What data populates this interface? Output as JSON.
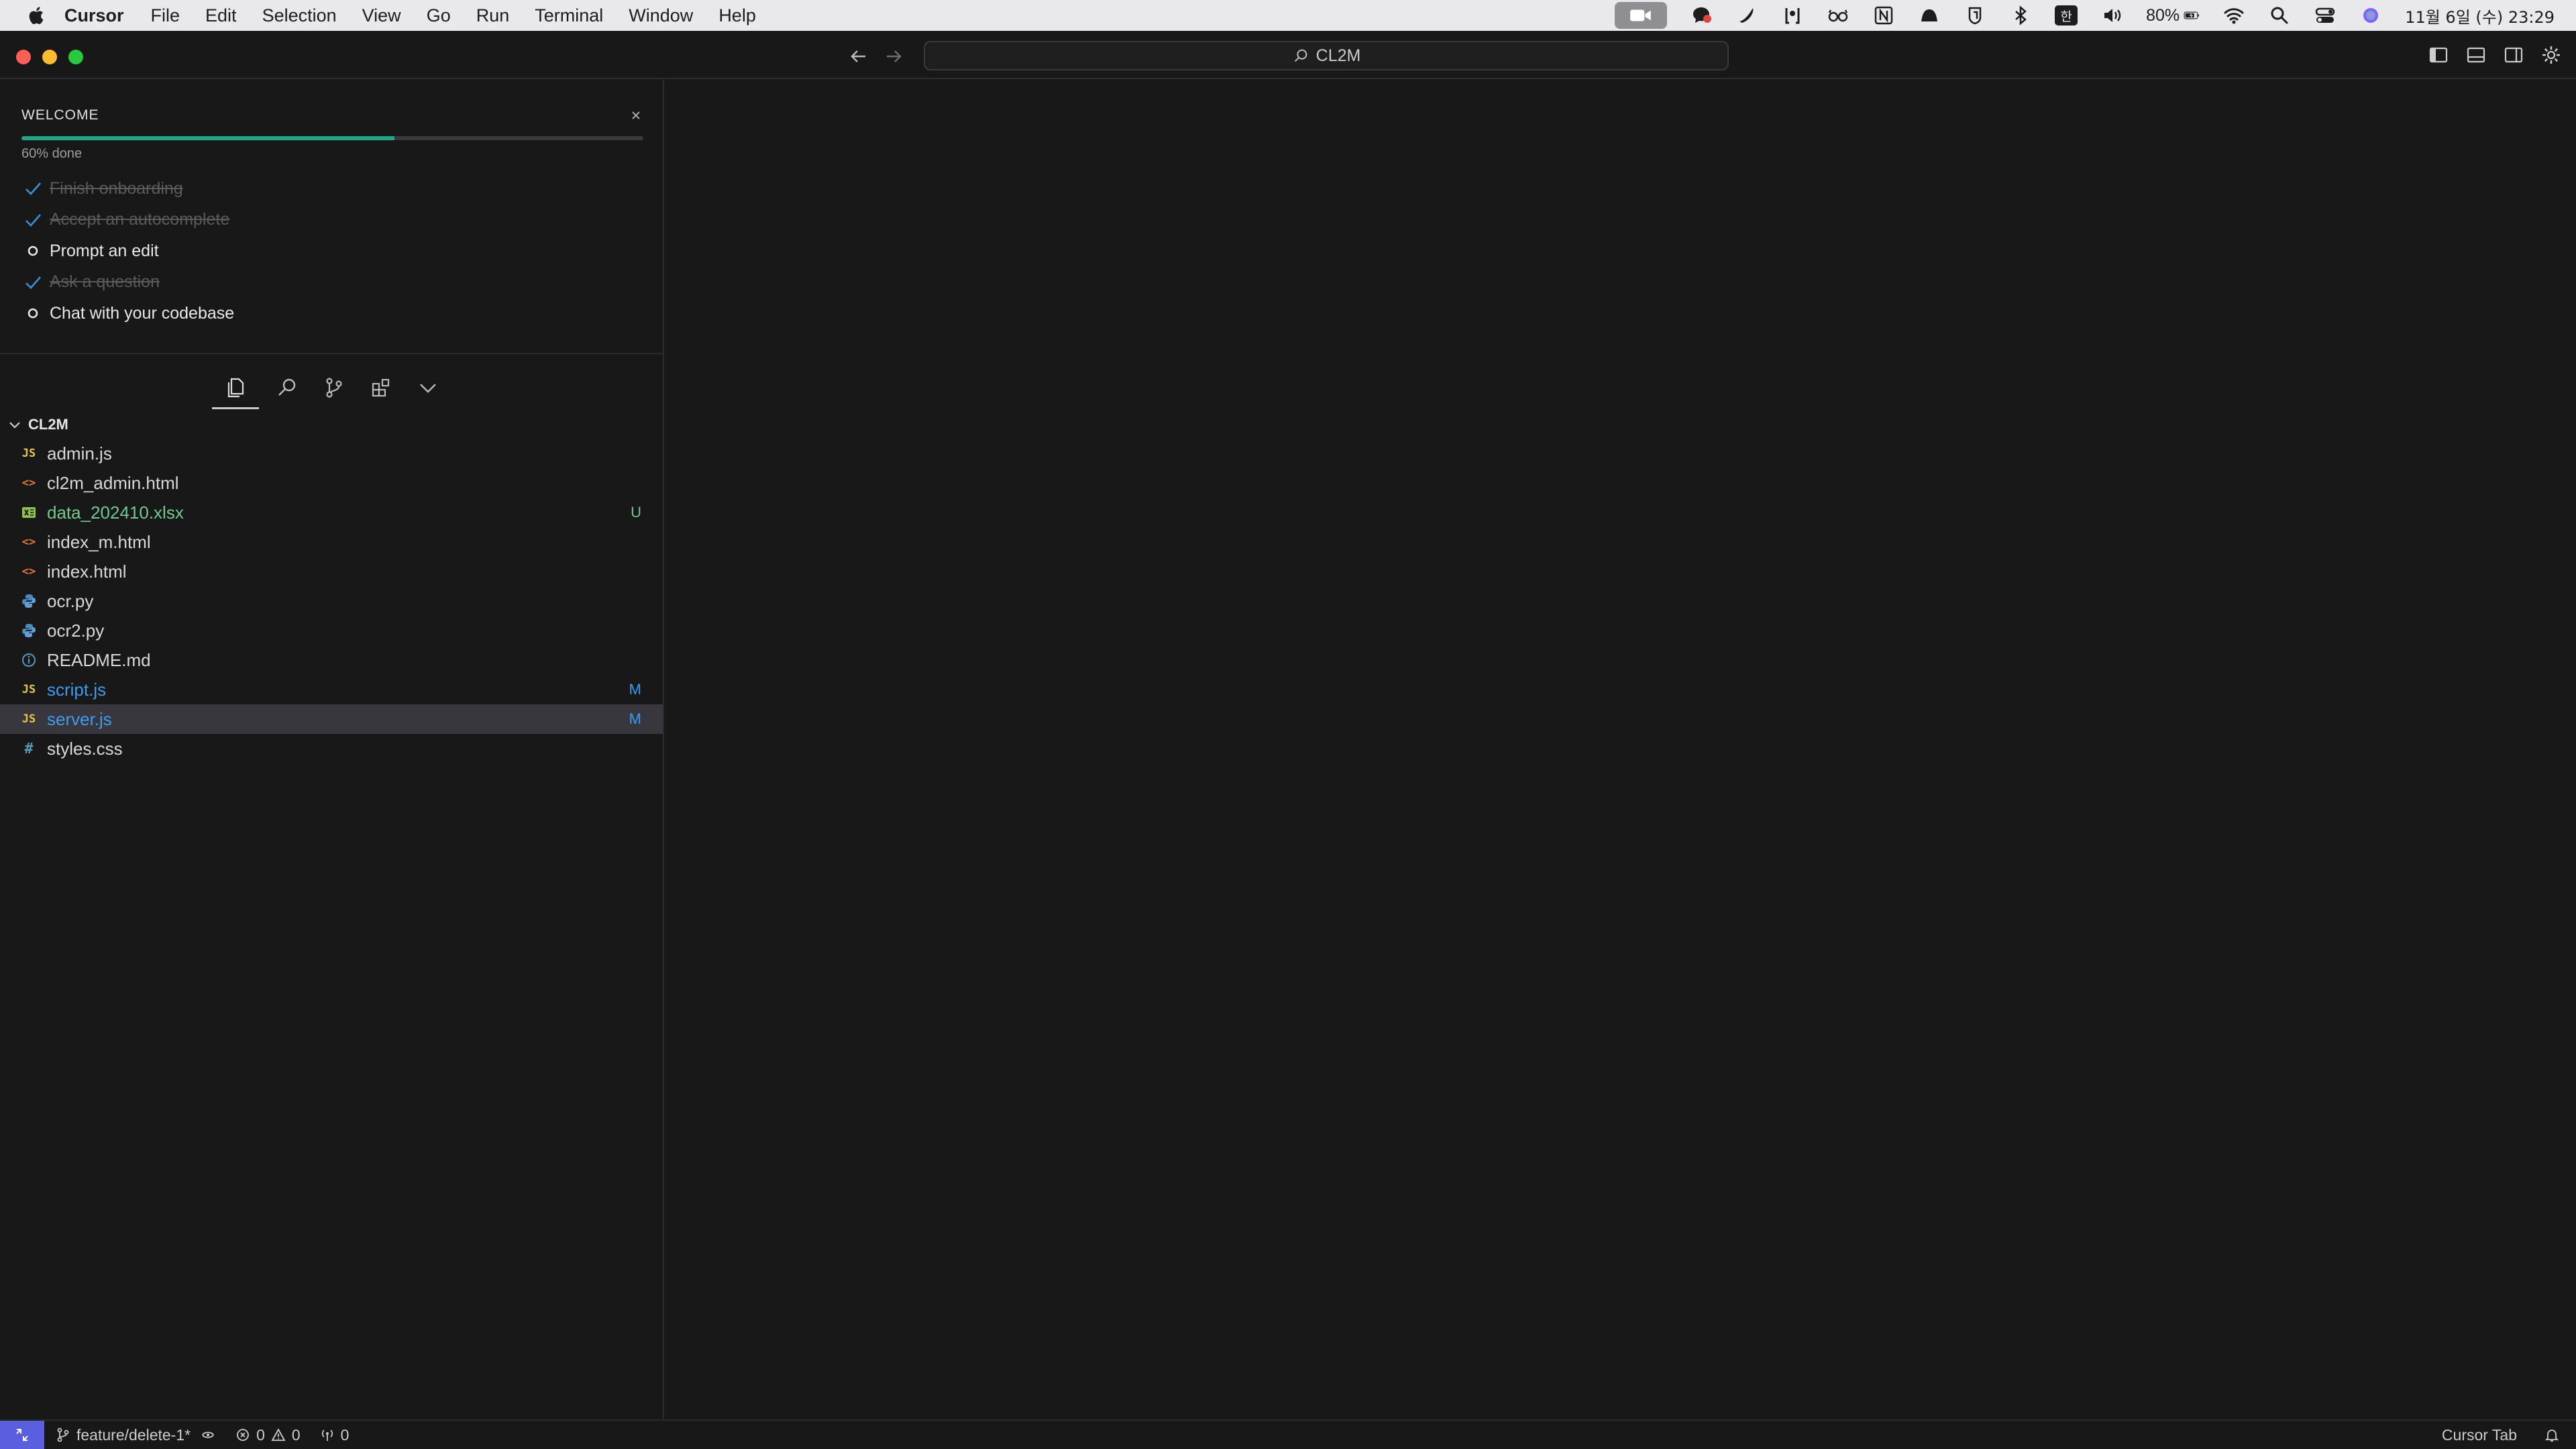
{
  "menubar": {
    "app_name": "Cursor",
    "items": [
      "File",
      "Edit",
      "Selection",
      "View",
      "Go",
      "Run",
      "Terminal",
      "Window",
      "Help"
    ],
    "battery_percent": "80%",
    "datetime": "11월 6일 (수) 23:29",
    "input_method": "한"
  },
  "window": {
    "search_label": "CL2M"
  },
  "welcome": {
    "title": "WELCOME",
    "progress": 0.6,
    "progress_label": "60% done",
    "items": [
      {
        "label": "Finish onboarding",
        "done": true
      },
      {
        "label": "Accept an autocomplete",
        "done": true
      },
      {
        "label": "Prompt an edit",
        "done": false
      },
      {
        "label": "Ask a question",
        "done": true
      },
      {
        "label": "Chat with your codebase",
        "done": false
      }
    ]
  },
  "explorer": {
    "folder_name": "CL2M",
    "files": [
      {
        "name": "admin.js",
        "type": "js",
        "status": ""
      },
      {
        "name": "cl2m_admin.html",
        "type": "html",
        "status": ""
      },
      {
        "name": "data_202410.xlsx",
        "type": "xlsx",
        "status": "U"
      },
      {
        "name": "index_m.html",
        "type": "html",
        "status": ""
      },
      {
        "name": "index.html",
        "type": "html",
        "status": ""
      },
      {
        "name": "ocr.py",
        "type": "py",
        "status": ""
      },
      {
        "name": "ocr2.py",
        "type": "py",
        "status": ""
      },
      {
        "name": "README.md",
        "type": "md",
        "status": ""
      },
      {
        "name": "script.js",
        "type": "js",
        "status": "M"
      },
      {
        "name": "server.js",
        "type": "js",
        "status": "M",
        "selected": true
      },
      {
        "name": "styles.css",
        "type": "css",
        "status": ""
      }
    ]
  },
  "statusbar": {
    "branch": "feature/delete-1*",
    "errors": "0",
    "warnings": "0",
    "ports": "0",
    "cursor_tab": "Cursor Tab"
  },
  "colors": {
    "accent_progress": "#1aa989",
    "remote_button": "#5a5fe0",
    "modified": "#3d9cf0",
    "untracked": "#73c991"
  }
}
